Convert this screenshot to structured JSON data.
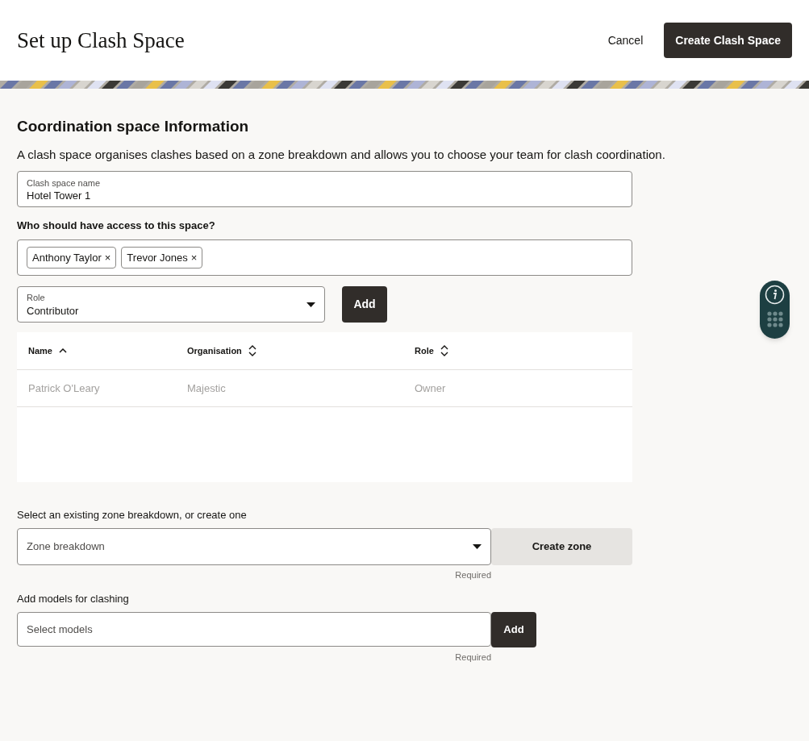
{
  "header": {
    "title": "Set up Clash Space",
    "cancel": "Cancel",
    "create": "Create Clash Space"
  },
  "section": {
    "heading": "Coordination space Information",
    "description": "A clash space organises clashes based on a zone breakdown and allows you to choose your team for clash coordination."
  },
  "name_field": {
    "label": "Clash space name",
    "value": "Hotel Tower 1"
  },
  "access": {
    "label": "Who should have access to this space?",
    "chips": [
      "Anthony Taylor",
      "Trevor Jones"
    ],
    "chip_remove": "×"
  },
  "role_select": {
    "label": "Role",
    "value": "Contributor"
  },
  "add_button": "Add",
  "table": {
    "columns": [
      {
        "label": "Name",
        "sorted": true
      },
      {
        "label": "Organisation",
        "sorted": false
      },
      {
        "label": "Role",
        "sorted": false
      }
    ],
    "rows": [
      {
        "cells": [
          "Patrick O'Leary",
          "Majestic",
          "Owner"
        ],
        "disabled": true
      }
    ]
  },
  "zone": {
    "label": "Select an existing zone breakdown, or create one",
    "placeholder": "Zone breakdown",
    "required": "Required",
    "create": "Create zone"
  },
  "models": {
    "label": "Add models for clashing",
    "placeholder": "Select models",
    "required": "Required",
    "add": "Add"
  }
}
